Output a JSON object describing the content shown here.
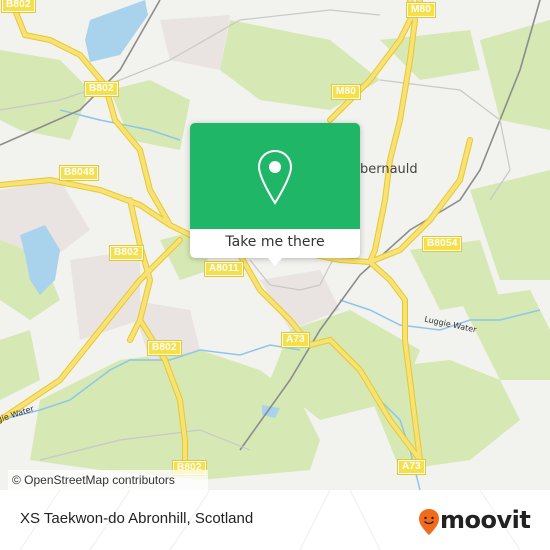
{
  "map": {
    "road_labels": [
      {
        "id": "b802-topleft",
        "text": "B802"
      },
      {
        "id": "b802-north",
        "text": "B802"
      },
      {
        "id": "m80-top",
        "text": "M80"
      },
      {
        "id": "m80-mid",
        "text": "M80"
      },
      {
        "id": "b8048",
        "text": "B8048"
      },
      {
        "id": "b802-west",
        "text": "B802"
      },
      {
        "id": "a8011",
        "text": "A8011"
      },
      {
        "id": "b8054",
        "text": "B8054"
      },
      {
        "id": "a73-center",
        "text": "A73"
      },
      {
        "id": "b802-south",
        "text": "B802"
      },
      {
        "id": "b802-bottom",
        "text": "B802"
      },
      {
        "id": "a73-bottom",
        "text": "A73"
      }
    ],
    "place_labels": [
      {
        "id": "cumbernauld",
        "text": "Cumbernauld"
      }
    ],
    "water_labels": [
      {
        "id": "luggie-water-east",
        "text": "Luggie Water"
      },
      {
        "id": "luggie-water-west",
        "text": "Luggie Water"
      }
    ],
    "attribution": "© OpenStreetMap contributors"
  },
  "popup": {
    "icon": "map-pin-icon",
    "button_label": "Take me there",
    "accent_color": "#1fb767"
  },
  "footer": {
    "title": "XS Taekwon-do Abronhill, Scotland",
    "brand": "moovit",
    "brand_color": "#f26b1d"
  }
}
